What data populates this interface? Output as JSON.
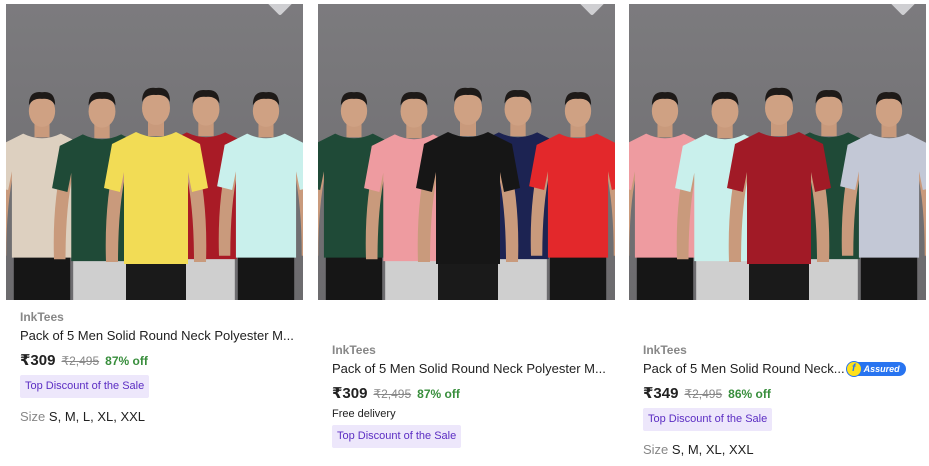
{
  "products": [
    {
      "brand": "InkTees",
      "title": "Pack of 5 Men Solid Round Neck Polyester M...",
      "price": "₹309",
      "mrp": "₹2,495",
      "discount": "87% off",
      "delivery": "",
      "badge": "Top Discount of the Sale",
      "size_label": "Size",
      "sizes": "S, M, L, XL, XXL",
      "assured": false,
      "shirt_colors": [
        "#ddd0c0",
        "#1f4a37",
        "#f2dc55",
        "#a91b26",
        "#c9f0ec"
      ]
    },
    {
      "brand": "InkTees",
      "title": "Pack of 5 Men Solid Round Neck Polyester M...",
      "price": "₹309",
      "mrp": "₹2,495",
      "discount": "87% off",
      "delivery": "Free delivery",
      "badge": "Top Discount of the Sale",
      "size_label": "",
      "sizes": "",
      "assured": false,
      "shirt_colors": [
        "#1f4a37",
        "#ee9ba0",
        "#161616",
        "#1c2352",
        "#e3282b"
      ]
    },
    {
      "brand": "InkTees",
      "title": "Pack of 5 Men Solid Round Neck...",
      "price": "₹349",
      "mrp": "₹2,495",
      "discount": "86% off",
      "delivery": "",
      "badge": "Top Discount of the Sale",
      "size_label": "Size",
      "sizes": "S, M, XL, XXL",
      "assured": true,
      "assured_text": "Assured",
      "shirt_colors": [
        "#ee9ba0",
        "#c9f0ec",
        "#a11a26",
        "#1f4a37",
        "#c3c8d6"
      ]
    }
  ],
  "colors": {
    "image_bg": "#747376",
    "brand_text": "#878787",
    "discount_green": "#388e3c",
    "badge_bg": "#ede7fb",
    "badge_text": "#5b2dc3",
    "assured_blue": "#2874f0"
  }
}
